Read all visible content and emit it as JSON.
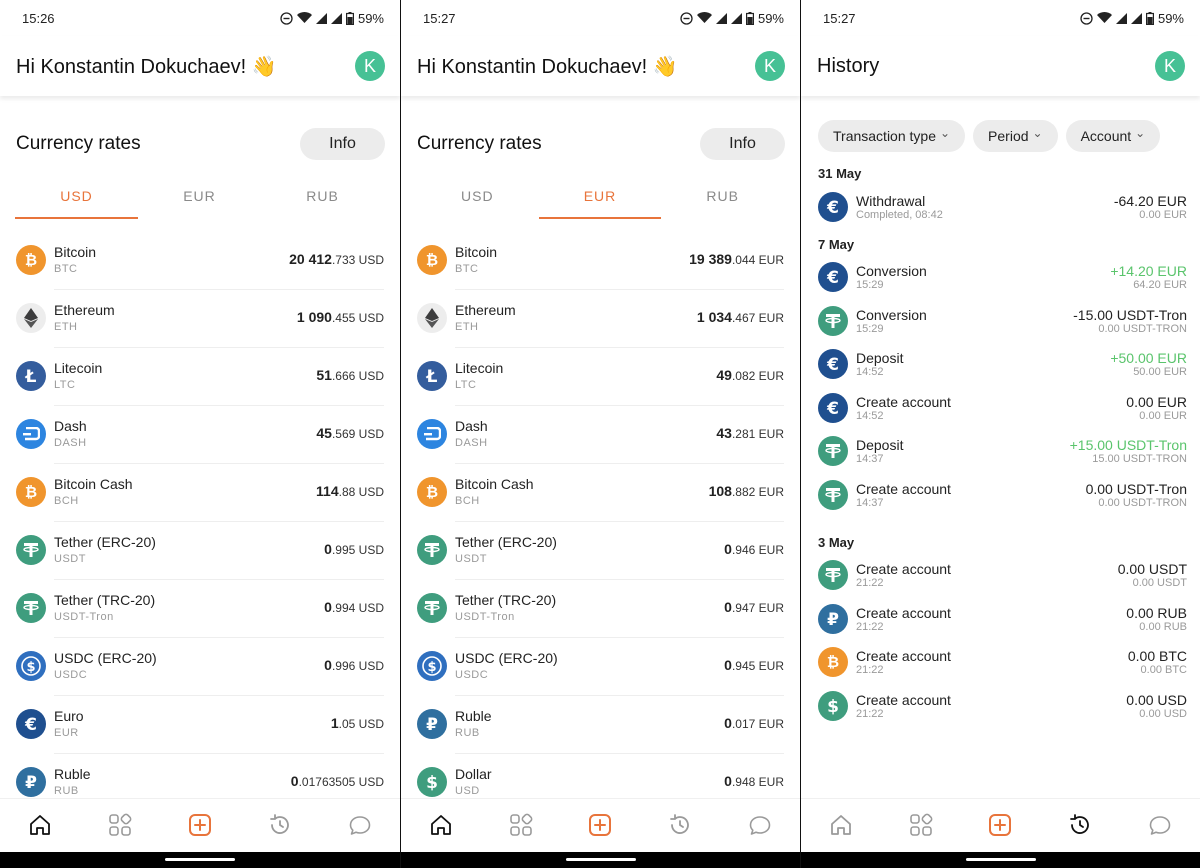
{
  "status": {
    "battery": "59%",
    "screens_time": [
      "15:26",
      "15:27",
      "15:27"
    ]
  },
  "greeting": "Hi Konstantin Dokuchaev! 👋",
  "avatar_letter": "K",
  "rates": {
    "title": "Currency rates",
    "info_button": "Info",
    "tabs": [
      "USD",
      "EUR",
      "RUB"
    ]
  },
  "screen1": {
    "active_tab": "USD",
    "rows": [
      {
        "name": "Bitcoin",
        "code": "BTC",
        "icon": "bitcoin-icon",
        "big": "20 412",
        "small": ".733 USD"
      },
      {
        "name": "Ethereum",
        "code": "ETH",
        "icon": "ethereum-icon",
        "big": "1 090",
        "small": ".455 USD"
      },
      {
        "name": "Litecoin",
        "code": "LTC",
        "icon": "litecoin-icon",
        "big": "51",
        "small": ".666 USD"
      },
      {
        "name": "Dash",
        "code": "DASH",
        "icon": "dash-icon",
        "big": "45",
        "small": ".569 USD"
      },
      {
        "name": "Bitcoin Cash",
        "code": "BCH",
        "icon": "bitcoin-cash-icon",
        "big": "114",
        "small": ".88 USD"
      },
      {
        "name": "Tether (ERC-20)",
        "code": "USDT",
        "icon": "tether-icon",
        "big": "0",
        "small": ".995 USD"
      },
      {
        "name": "Tether (TRC-20)",
        "code": "USDT-Tron",
        "icon": "tether-icon",
        "big": "0",
        "small": ".994 USD"
      },
      {
        "name": "USDC (ERC-20)",
        "code": "USDC",
        "icon": "usdc-icon",
        "big": "0",
        "small": ".996 USD"
      },
      {
        "name": "Euro",
        "code": "EUR",
        "icon": "euro-icon",
        "big": "1",
        "small": ".05 USD"
      },
      {
        "name": "Ruble",
        "code": "RUB",
        "icon": "ruble-icon",
        "big": "0",
        "small": ".01763505 USD"
      }
    ]
  },
  "screen2": {
    "active_tab": "EUR",
    "rows": [
      {
        "name": "Bitcoin",
        "code": "BTC",
        "icon": "bitcoin-icon",
        "big": "19 389",
        "small": ".044 EUR"
      },
      {
        "name": "Ethereum",
        "code": "ETH",
        "icon": "ethereum-icon",
        "big": "1 034",
        "small": ".467 EUR"
      },
      {
        "name": "Litecoin",
        "code": "LTC",
        "icon": "litecoin-icon",
        "big": "49",
        "small": ".082 EUR"
      },
      {
        "name": "Dash",
        "code": "DASH",
        "icon": "dash-icon",
        "big": "43",
        "small": ".281 EUR"
      },
      {
        "name": "Bitcoin Cash",
        "code": "BCH",
        "icon": "bitcoin-cash-icon",
        "big": "108",
        "small": ".882 EUR"
      },
      {
        "name": "Tether (ERC-20)",
        "code": "USDT",
        "icon": "tether-icon",
        "big": "0",
        "small": ".946 EUR"
      },
      {
        "name": "Tether (TRC-20)",
        "code": "USDT-Tron",
        "icon": "tether-icon",
        "big": "0",
        "small": ".947 EUR"
      },
      {
        "name": "USDC (ERC-20)",
        "code": "USDC",
        "icon": "usdc-icon",
        "big": "0",
        "small": ".945 EUR"
      },
      {
        "name": "Ruble",
        "code": "RUB",
        "icon": "ruble-icon",
        "big": "0",
        "small": ".017 EUR"
      },
      {
        "name": "Dollar",
        "code": "USD",
        "icon": "dollar-icon",
        "big": "0",
        "small": ".948 EUR"
      }
    ]
  },
  "history": {
    "title": "History",
    "filters": [
      "Transaction type",
      "Period",
      "Account"
    ],
    "groups": [
      {
        "date": "31 May",
        "items": [
          {
            "icon": "euro-icon",
            "title": "Withdrawal",
            "sub": "Completed, 08:42",
            "amount": "-64.20 EUR",
            "balance": "0.00 EUR",
            "positive": false
          }
        ]
      },
      {
        "date": "7 May",
        "items": [
          {
            "icon": "euro-icon",
            "title": "Conversion",
            "sub": "15:29",
            "amount": "+14.20 EUR",
            "balance": "64.20 EUR",
            "positive": true
          },
          {
            "icon": "tether-icon",
            "title": "Conversion",
            "sub": "15:29",
            "amount": "-15.00 USDT-Tron",
            "balance": "0.00 USDT-TRON",
            "positive": false
          },
          {
            "icon": "euro-icon",
            "title": "Deposit",
            "sub": "14:52",
            "amount": "+50.00 EUR",
            "balance": "50.00 EUR",
            "positive": true
          },
          {
            "icon": "euro-icon",
            "title": "Create account",
            "sub": "14:52",
            "amount": "0.00 EUR",
            "balance": "0.00 EUR",
            "positive": false
          },
          {
            "icon": "tether-icon",
            "title": "Deposit",
            "sub": "14:37",
            "amount": "+15.00 USDT-Tron",
            "balance": "15.00 USDT-TRON",
            "positive": true
          },
          {
            "icon": "tether-icon",
            "title": "Create account",
            "sub": "14:37",
            "amount": "0.00 USDT-Tron",
            "balance": "0.00 USDT-TRON",
            "positive": false
          }
        ]
      },
      {
        "date": "3 May",
        "items": [
          {
            "icon": "tether-icon",
            "title": "Create account",
            "sub": "21:22",
            "amount": "0.00 USDT",
            "balance": "0.00 USDT",
            "positive": false
          },
          {
            "icon": "ruble-icon",
            "title": "Create account",
            "sub": "21:22",
            "amount": "0.00 RUB",
            "balance": "0.00 RUB",
            "positive": false
          },
          {
            "icon": "bitcoin-icon",
            "title": "Create account",
            "sub": "21:22",
            "amount": "0.00 BTC",
            "balance": "0.00 BTC",
            "positive": false
          },
          {
            "icon": "dollar-icon",
            "title": "Create account",
            "sub": "21:22",
            "amount": "0.00 USD",
            "balance": "0.00 USD",
            "positive": false
          }
        ]
      }
    ]
  },
  "nav_items": [
    "home-icon",
    "apps-icon",
    "add-icon",
    "history-icon",
    "chat-icon"
  ],
  "colors": {
    "accent": "#e8743b",
    "avatar": "#46c195",
    "positive": "#5ac46c",
    "bitcoin": "#f0952d",
    "tether": "#3f9d7e",
    "litecoin": "#345d9d",
    "dash": "#2d85e0",
    "usdc": "#2f6fbf",
    "euro": "#1f4f8f",
    "ruble": "#2f6f9f",
    "dollar": "#3f9d7e"
  }
}
